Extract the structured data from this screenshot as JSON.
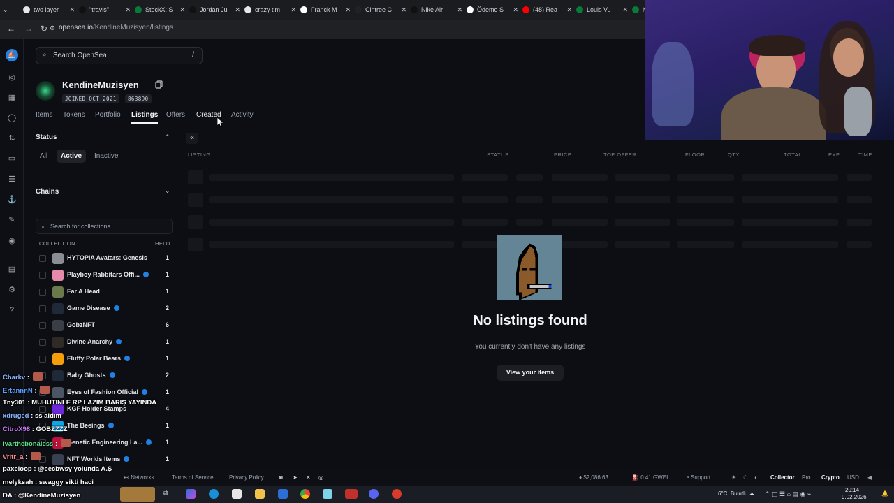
{
  "browser": {
    "tabs": [
      {
        "title": "two layer",
        "color": "#e5e7eb"
      },
      {
        "title": "\"travis\"",
        "color": "#111111"
      },
      {
        "title": "StockX: S",
        "color": "#0a7a3a"
      },
      {
        "title": "Jordan Ju",
        "color": "#111111"
      },
      {
        "title": "crazy tim",
        "color": "#e5e7eb"
      },
      {
        "title": "Franck M",
        "color": "#ffffff"
      },
      {
        "title": "Cintree C",
        "color": "#222222"
      },
      {
        "title": "Nike Air",
        "color": "#111111"
      },
      {
        "title": "Ödeme S",
        "color": "#ffffff"
      },
      {
        "title": "(48) Rea",
        "color": "#ff0000"
      },
      {
        "title": "Louis Vu",
        "color": "#0a7a3a"
      },
      {
        "title": "lv",
        "color": "#0a7a3a"
      }
    ],
    "url_host": "opensea.io",
    "url_path": "/KendineMuzisyen/listings"
  },
  "header": {
    "search_placeholder": "Search OpenSea",
    "search_shortcut": "/"
  },
  "profile": {
    "username": "KendineMuzisyen",
    "joined": "JOINED OCT 2021",
    "address": "8638D0",
    "tabs": [
      "Items",
      "Tokens",
      "Portfolio",
      "Listings",
      "Offers",
      "Created",
      "Activity"
    ],
    "active_tab": "Listings"
  },
  "filters": {
    "status_title": "Status",
    "status_options": [
      "All",
      "Active",
      "Inactive"
    ],
    "active_status": "Active",
    "chains_title": "Chains",
    "collections_search_placeholder": "Search for collections",
    "collection_header": "COLLECTION",
    "held_header": "HELD",
    "collections": [
      {
        "name": "HYTOPIA Avatars: Genesis",
        "held": "1",
        "verified": false,
        "thumb": "#8a8d94"
      },
      {
        "name": "Playboy Rabbitars Offi...",
        "held": "1",
        "verified": true,
        "thumb": "#e58aa8"
      },
      {
        "name": "Far A Head",
        "held": "1",
        "verified": false,
        "thumb": "#6b7a4a"
      },
      {
        "name": "Game Disease",
        "held": "2",
        "verified": true,
        "thumb": "#1f2937"
      },
      {
        "name": "GobzNFT",
        "held": "6",
        "verified": false,
        "thumb": "#3a3f47"
      },
      {
        "name": "Divine Anarchy",
        "held": "1",
        "verified": true,
        "thumb": "#2f2a26"
      },
      {
        "name": "Fluffy Polar Bears",
        "held": "1",
        "verified": true,
        "thumb": "#f59e0b"
      },
      {
        "name": "Baby Ghosts",
        "held": "2",
        "verified": true,
        "thumb": "#1f2937"
      },
      {
        "name": "Eyes of Fashion Official",
        "held": "1",
        "verified": true,
        "thumb": "#4b5563"
      },
      {
        "name": "KGF Holder Stamps",
        "held": "4",
        "verified": false,
        "thumb": "#6d28d9"
      },
      {
        "name": "The Beeings",
        "held": "1",
        "verified": true,
        "thumb": "#0ea5e9"
      },
      {
        "name": "Genetic Engineering La...",
        "held": "1",
        "verified": true,
        "thumb": "#be123c"
      },
      {
        "name": "NFT Worlds Items",
        "held": "1",
        "verified": true,
        "thumb": "#374151"
      }
    ]
  },
  "table": {
    "columns": [
      "LISTING",
      "STATUS",
      "PRICE",
      "TOP OFFER",
      "FLOOR",
      "QTY",
      "TOTAL",
      "EXP",
      "TIME"
    ]
  },
  "empty_state": {
    "title": "No listings found",
    "subtitle": "You currently don't have any listings",
    "button": "View your items"
  },
  "footer": {
    "links": [
      "Networks",
      "Terms of Service",
      "Privacy Policy"
    ],
    "eth_price": "$2,086.63",
    "gas": "0.41 GWEI",
    "support": "Support",
    "modes": [
      "Collector",
      "Pro"
    ],
    "currency": [
      "Crypto",
      "USD"
    ]
  },
  "taskbar": {
    "weather": "6°C  Bulutlu",
    "time": "20:14",
    "date": "9.02.2026"
  },
  "chat": [
    {
      "user": "Charkv",
      "color": "#8ab4ff",
      "msg": "",
      "emote": "#b45a4a"
    },
    {
      "user": "ErtannnN",
      "color": "#5aa0ff",
      "msg": "",
      "emote": "#b45a4a"
    },
    {
      "user": "Tny301",
      "color": "#ffffff",
      "msg": "MUHUTINLE RP LAZIM BARIŞ YAYINDA",
      "emote": ""
    },
    {
      "user": "xdruged",
      "color": "#8ab4ff",
      "msg": "ss aldım",
      "emote": ""
    },
    {
      "user": "CitroX98",
      "color": "#d17cff",
      "msg": "GOBZZZZ",
      "emote": ""
    },
    {
      "user": "Ivarthebonaless",
      "color": "#5ee08a",
      "msg": "",
      "emote": "#b45a4a"
    },
    {
      "user": "Vritr_a",
      "color": "#ff8a8a",
      "msg": "",
      "emote": "#b45a4a"
    },
    {
      "user": "paxeloop",
      "color": "#ffffff",
      "msg": "@eecbwsy yolunda A.Ş",
      "emote": ""
    },
    {
      "user": "melyksah",
      "color": "#ffffff",
      "msg": "swaggy sikti haci",
      "emote": ""
    },
    {
      "user": "DA",
      "color": "#ffffff",
      "msg": "@KendineMuzisyen",
      "emote": ""
    }
  ]
}
